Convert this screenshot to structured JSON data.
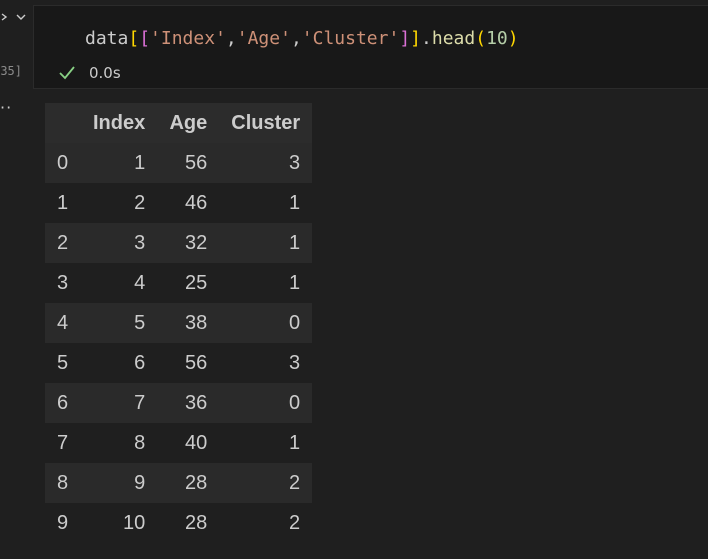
{
  "gutter": {
    "execution_count": "35]"
  },
  "cell": {
    "code": {
      "var": "data",
      "open_outer": "[",
      "open_inner": "[",
      "str1": "'Index'",
      "comma1": ",",
      "str2": "'Age'",
      "comma2": ",",
      "str3": "'Cluster'",
      "close_inner": "]",
      "close_outer": "]",
      "dot": ".",
      "fn": "head",
      "paren_open": "(",
      "arg": "10",
      "paren_close": ")"
    },
    "status": {
      "duration": "0.0s",
      "icon": "check-icon"
    }
  },
  "output": {
    "columns": [
      "",
      "Index",
      "Age",
      "Cluster"
    ],
    "rows": [
      [
        "0",
        "1",
        "56",
        "3"
      ],
      [
        "1",
        "2",
        "46",
        "1"
      ],
      [
        "2",
        "3",
        "32",
        "1"
      ],
      [
        "3",
        "4",
        "25",
        "1"
      ],
      [
        "4",
        "5",
        "38",
        "0"
      ],
      [
        "5",
        "6",
        "56",
        "3"
      ],
      [
        "6",
        "7",
        "36",
        "0"
      ],
      [
        "7",
        "8",
        "40",
        "1"
      ],
      [
        "8",
        "9",
        "28",
        "2"
      ],
      [
        "9",
        "10",
        "28",
        "2"
      ]
    ]
  },
  "colors": {
    "background": "#1f1f1f",
    "cell_background": "#181818",
    "check": "#89d185",
    "string": "#ce9178",
    "bracket_gold": "#ffd700",
    "bracket_purple": "#da70d6",
    "function": "#dcdcaa",
    "number": "#b5cea8"
  }
}
